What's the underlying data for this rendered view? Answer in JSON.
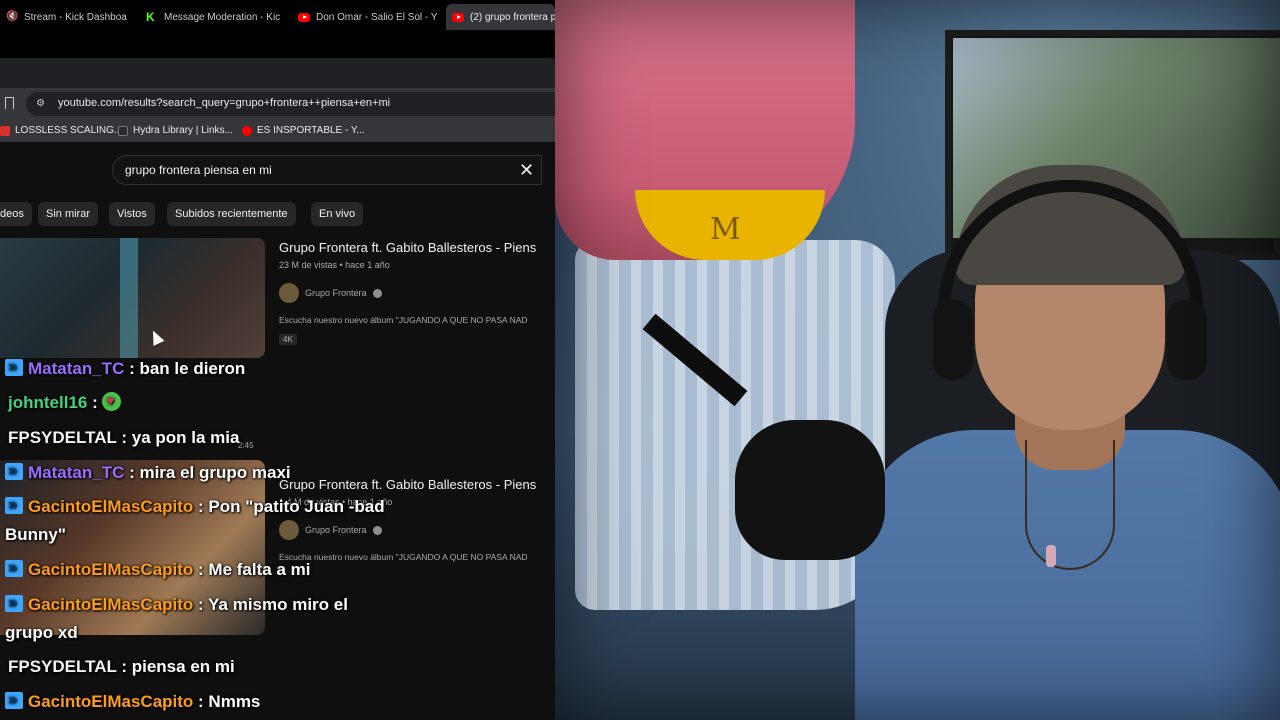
{
  "browser": {
    "tabs": [
      {
        "label": "Stream - Kick Dashboa",
        "icon": "mute-icon"
      },
      {
        "label": "Message Moderation - Kic",
        "icon": "kick-icon"
      },
      {
        "label": "Don Omar - Salio El Sol - Y",
        "icon": "youtube-icon"
      },
      {
        "label": "(2) grupo frontera p",
        "icon": "youtube-icon",
        "active": true
      }
    ],
    "url": "youtube.com/results?search_query=grupo+frontera++piensa+en+mi",
    "bookmarks": [
      {
        "label": "LOSSLESS SCALING...",
        "color": "#d9332b"
      },
      {
        "label": "Hydra Library | Links...",
        "color": "#2b2b2b"
      },
      {
        "label": "ES INSPORTABLE - Y...",
        "color": "#ff0000"
      }
    ]
  },
  "youtube": {
    "search_value": "grupo frontera  piensa en mi",
    "filter_chips": [
      "deos",
      "Sin mirar",
      "Vistos",
      "Subidos recientemente",
      "En vivo"
    ],
    "results": [
      {
        "title": "Grupo Frontera ft. Gabito Ballesteros - Piens",
        "meta": "23 M de vistas • hace 1 año",
        "channel": "Grupo Frontera",
        "description": "Escucha nuestro nuevo álbum \"JUGANDO A QUE NO PASA NAD",
        "badge": "4K"
      },
      {
        "title": "Grupo Frontera ft. Gabito Ballesteros - Piens",
        "meta": "1,4 M de vistas • hace 1 año",
        "channel": "Grupo Frontera",
        "description": "Escucha nuestro nuevo álbum \"JUGANDO A QUE NO PASA NAD"
      }
    ],
    "duration_fragment": "2:45"
  },
  "chat": [
    {
      "user": "Matatan_TC",
      "sep": " : ",
      "text": "ban le dieron",
      "badge": true,
      "color": "#9a6dff"
    },
    {
      "user": "johntell16",
      "sep": " : ",
      "text": "",
      "badge": false,
      "color": "#44d47a",
      "emote": "heart-emote"
    },
    {
      "user": "FPSYDELTAL",
      "sep": " : ",
      "text": "ya pon la mia",
      "badge": false,
      "color": "#f2f2f2"
    },
    {
      "user": "Matatan_TC",
      "sep": " : ",
      "text": "mira el grupo maxi",
      "badge": true,
      "color": "#9a6dff"
    },
    {
      "user": "GacintoElMasCapito",
      "sep": " : ",
      "text": "Pon \"patito Juan -bad Bunny\"",
      "badge": true,
      "color": "#ff9c1a"
    },
    {
      "user": "GacintoElMasCapito",
      "sep": " : ",
      "text": "Me falta a mi",
      "badge": true,
      "color": "#ff9c1a"
    },
    {
      "user": "GacintoElMasCapito",
      "sep": " : ",
      "text": "Ya mismo miro el grupo xd",
      "badge": true,
      "color": "#ff9c1a"
    },
    {
      "user": "FPSYDELTAL",
      "sep": " : ",
      "text": "piensa en mi",
      "badge": false,
      "color": "#f2f2f2"
    },
    {
      "user": "GacintoElMasCapito",
      "sep": " : ",
      "text": "Nmms",
      "badge": true,
      "color": "#ff9c1a"
    }
  ]
}
